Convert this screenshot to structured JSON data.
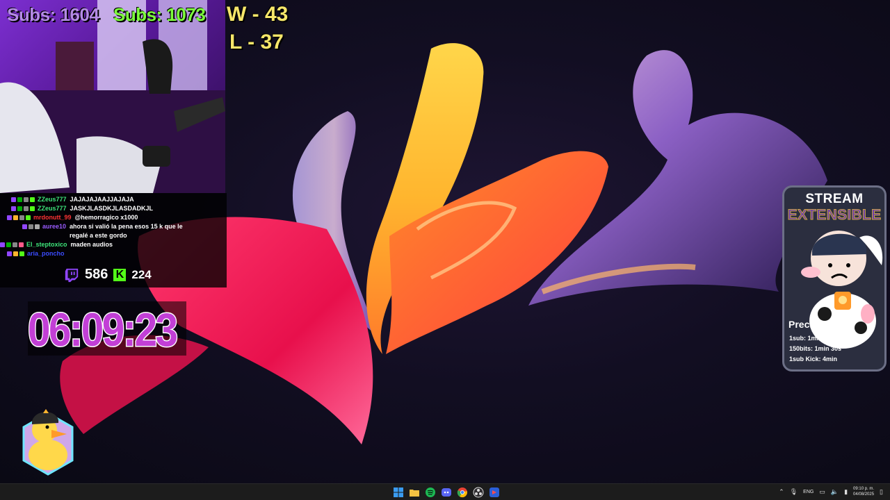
{
  "overlay": {
    "subs_a": "Subs: 1604",
    "subs_b": "Subs: 1073",
    "wins": "W - 43",
    "losses": "L  - 37",
    "twitch_count": "586",
    "kick_count": "224",
    "timer": "06:09:23"
  },
  "chat": {
    "messages": [
      {
        "user": "ZZeus777",
        "text": "JAJAJAJAAJJAJAJA",
        "color": "#3ee67a"
      },
      {
        "user": "ZZeus777",
        "text": "JASKJLASDKJLASDADKJL",
        "color": "#3ee67a"
      },
      {
        "user": "mrdonutt_99",
        "text": "@hemorragico x1000",
        "color": "#ff3333"
      },
      {
        "user": "auree10",
        "text": "ahora si valió la pena esos 15 k que le regalé a este gordo",
        "color": "#9a5cff"
      },
      {
        "user": "El_steptoxico",
        "text": "maden audios",
        "color": "#3ee67a"
      },
      {
        "user": "aria_poncho",
        "text": "",
        "color": "#3b4cff"
      }
    ]
  },
  "card": {
    "title1": "STREAM",
    "title2": "EXTENSIBLE",
    "precios": "Precios",
    "prices": [
      "1sub: 1min 30s",
      "150bits: 1min 30s",
      "1sub Kick: 4min"
    ]
  },
  "taskbar": {
    "lang": "ENG",
    "time": "09:10 p. m.",
    "date": "04/08/2025",
    "icons": [
      "windows-start-icon",
      "file-explorer-icon",
      "spotify-icon",
      "discord-icon",
      "chrome-icon",
      "obs-icon",
      "game-icon"
    ]
  },
  "colors": {
    "timer": "#c23fd6",
    "subs_a": "#b48ae6",
    "subs_b": "#7dff3c",
    "wl": "#f6e66a",
    "kick": "#53fc18",
    "twitch": "#9146ff"
  }
}
